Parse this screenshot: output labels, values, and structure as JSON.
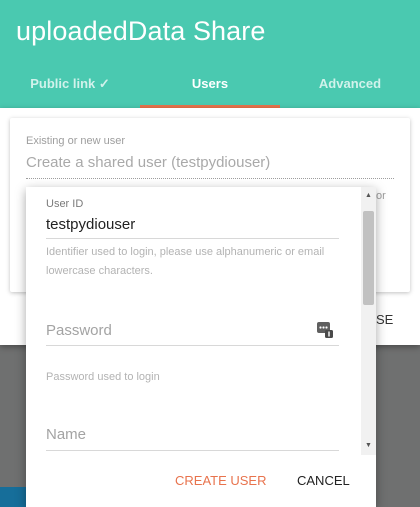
{
  "header": {
    "title": "uploadedData Share",
    "tabs": [
      {
        "label": "Public link ✓",
        "active": false
      },
      {
        "label": "Users",
        "active": true
      },
      {
        "label": "Advanced",
        "active": false
      }
    ],
    "background_color": "#4ac9b0",
    "indicator_color": "#e8734d"
  },
  "user_search": {
    "label": "Existing or new user",
    "placeholder": "Create a shared user (testpydiouser)"
  },
  "clipped": {
    "or_text": "or",
    "close_text": "SE"
  },
  "create_user_form": {
    "user_id": {
      "label": "User ID",
      "value": "testpydiouser",
      "helper": "Identifier used to login, please use alphanumeric or email lowercase characters."
    },
    "password": {
      "placeholder": "Password",
      "helper": "Password used to login",
      "toggle_icon": "password-key-icon"
    },
    "name": {
      "placeholder": "Name"
    },
    "actions": {
      "create_label": "CREATE USER",
      "cancel_label": "CANCEL"
    },
    "accent_color": "#e8734d"
  }
}
